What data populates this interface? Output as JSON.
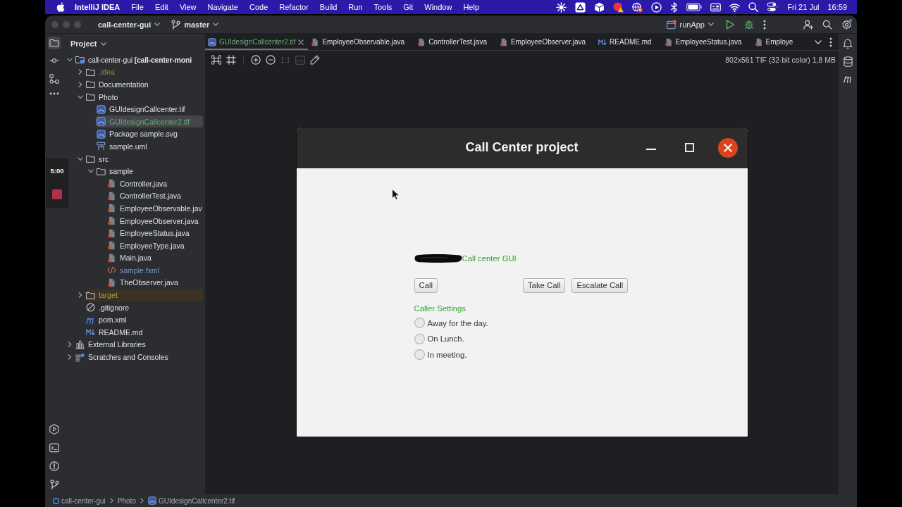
{
  "menubar": {
    "app_name": "IntelliJ IDEA",
    "menus": [
      "File",
      "Edit",
      "View",
      "Navigate",
      "Code",
      "Refactor",
      "Build",
      "Run",
      "Tools",
      "Git",
      "Window",
      "Help"
    ],
    "date": "Fri 21 Jul",
    "time": "16:59"
  },
  "titlebar": {
    "project": "call-center-gui",
    "branch": "master",
    "run_configuration": "runApp"
  },
  "project_panel": {
    "title": "Project",
    "button_selected": true,
    "tree": [
      {
        "label": "call-center-gui **[call-center-moni**",
        "kind": "module",
        "expanded": true,
        "selected": false,
        "children": [
          {
            "label": ".idea",
            "kind": "folder",
            "expanded": false,
            "selected": false,
            "color": "#8f9446"
          },
          {
            "label": "Documentation",
            "kind": "folder",
            "expanded": false,
            "selected": false
          },
          {
            "label": "Photo",
            "kind": "folder",
            "expanded": true,
            "selected": false,
            "children": [
              {
                "label": "GUIdesignCallcenter.tif",
                "kind": "image",
                "selected": false
              },
              {
                "label": "GUIdesignCallcenter2.tif",
                "kind": "image",
                "selected": true,
                "color": "#6aab73"
              },
              {
                "label": "Package sample.svg",
                "kind": "image",
                "selected": false
              },
              {
                "label": "sample.uml",
                "kind": "diagram",
                "selected": false
              }
            ]
          },
          {
            "label": "src",
            "kind": "folder",
            "expanded": true,
            "selected": false,
            "children": [
              {
                "label": "sample",
                "kind": "folder",
                "expanded": true,
                "selected": false,
                "children": [
                  {
                    "label": "Controller.java",
                    "kind": "java",
                    "selected": false
                  },
                  {
                    "label": "ControllerTest.java",
                    "kind": "java",
                    "selected": false
                  },
                  {
                    "label": "EmployeeObservable.jav",
                    "kind": "java",
                    "selected": false
                  },
                  {
                    "label": "EmployeeObserver.java",
                    "kind": "java",
                    "selected": false
                  },
                  {
                    "label": "EmployeeStatus.java",
                    "kind": "java",
                    "selected": false
                  },
                  {
                    "label": "EmployeeType.java",
                    "kind": "java",
                    "selected": false
                  },
                  {
                    "label": "Main.java",
                    "kind": "java",
                    "selected": false
                  },
                  {
                    "label": "sample.fxml",
                    "kind": "markup",
                    "selected": false,
                    "color": "#7b9ad0"
                  },
                  {
                    "label": "TheObserver.java",
                    "kind": "java",
                    "selected": false
                  }
                ]
              }
            ]
          },
          {
            "label": "target",
            "kind": "excluded_folder",
            "expanded": false,
            "selected": false,
            "color": "#b39d52"
          },
          {
            "label": ".gitignore",
            "kind": "ignore",
            "selected": false
          },
          {
            "label": "pom.xml",
            "kind": "maven",
            "selected": false
          },
          {
            "label": "README.md",
            "kind": "markdown",
            "selected": false
          }
        ]
      },
      {
        "label": "External Libraries",
        "kind": "libraries",
        "expanded": false,
        "selected": false
      },
      {
        "label": "Scratches and Consoles",
        "kind": "scratches",
        "expanded": false,
        "selected": false
      }
    ]
  },
  "editor": {
    "tabs": [
      {
        "label": "GUIdesignCallcenter2.tif",
        "kind": "image",
        "selected": true,
        "color": "#6aab73"
      },
      {
        "label": "EmployeeObservable.java",
        "kind": "java",
        "selected": false
      },
      {
        "label": "ControllerTest.java",
        "kind": "java",
        "selected": false
      },
      {
        "label": "EmployeeObserver.java",
        "kind": "java",
        "selected": false
      },
      {
        "label": "README.md",
        "kind": "markdown",
        "selected": false
      },
      {
        "label": "EmployeeStatus.java",
        "kind": "java",
        "selected": false
      },
      {
        "label": "Employe",
        "kind": "java",
        "selected": false
      }
    ],
    "toolbar": {
      "actual_size": {
        "label": "1:1",
        "disabled": true
      },
      "image_button": {
        "disabled": true
      }
    },
    "image_info": "802x561 TIF (32-bit color) 1,8 MB",
    "image": {
      "window_title": "Call Center project",
      "heading": "Call center GUI",
      "left_buttons": [
        "Call"
      ],
      "right_buttons": [
        "Take Call",
        "Escalate Call"
      ],
      "section_title": "Caller Settings",
      "options": [
        {
          "label": "Away for the day.",
          "selected": false
        },
        {
          "label": "On Lunch.",
          "selected": false
        },
        {
          "label": "In meeting.",
          "selected": false
        }
      ]
    }
  },
  "recording": {
    "elapsed": "5:00"
  },
  "breadcrumbs": [
    {
      "label": "call-center-gui",
      "kind": "module"
    },
    {
      "label": "Photo",
      "kind": "folder"
    },
    {
      "label": "GUIdesignCallcenter2.tif",
      "kind": "image"
    }
  ]
}
